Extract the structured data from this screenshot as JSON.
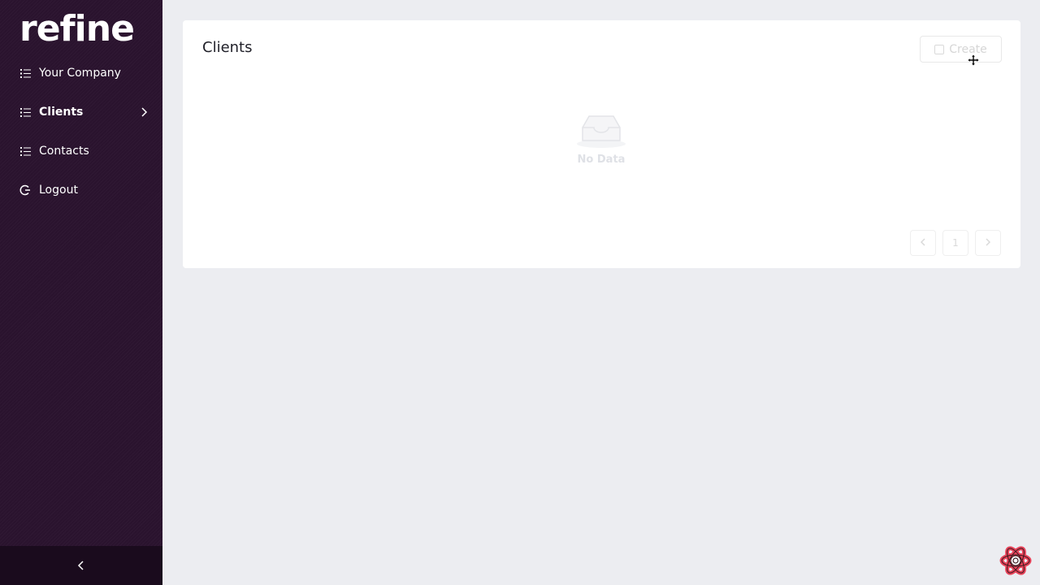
{
  "app": {
    "logo_text": "refine"
  },
  "sidebar": {
    "items": [
      {
        "label": "Your Company",
        "icon": "list-icon"
      },
      {
        "label": "Clients",
        "icon": "list-icon",
        "active": true
      },
      {
        "label": "Contacts",
        "icon": "list-icon"
      },
      {
        "label": "Logout",
        "icon": "logout-icon"
      }
    ],
    "collapse_icon": "chevron-left-icon"
  },
  "main": {
    "title": "Clients",
    "create_label": "Create",
    "empty_label": "No Data",
    "pagination": {
      "current_page": "1"
    }
  },
  "colors": {
    "sidebar_bg": "#2a132e",
    "content_bg": "#ecedf1",
    "card_bg": "#ffffff",
    "devtools_accent": "#e8435a"
  }
}
